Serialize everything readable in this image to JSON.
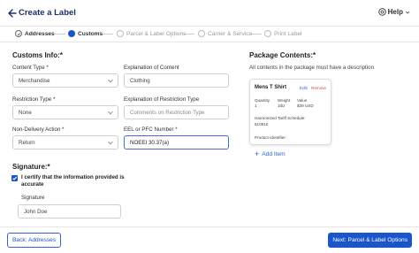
{
  "header": {
    "title": "Create a Label",
    "help_label": "Help"
  },
  "stepper": {
    "steps": [
      {
        "label": "Addresses",
        "state": "done"
      },
      {
        "label": "Customs",
        "state": "active"
      },
      {
        "label": "Parcel & Label Options",
        "state": "pending"
      },
      {
        "label": "Carrier & Service",
        "state": "pending"
      },
      {
        "label": "Print Label",
        "state": "pending"
      }
    ]
  },
  "customs": {
    "title": "Customs Info:*",
    "content_type": {
      "label": "Content Type *",
      "value": "Merchandise"
    },
    "explanation_content": {
      "label": "Explanation of Content",
      "value": "Clothing"
    },
    "restriction_type": {
      "label": "Restriction Type *",
      "value": "None"
    },
    "explanation_restriction": {
      "label": "Explanation of Restriction Type",
      "placeholder": "Comments on Restriction Type"
    },
    "non_delivery": {
      "label": "Non-Delivery Action *",
      "value": "Return"
    },
    "eel_pfc": {
      "label": "EEL or PFC Number *",
      "value": "NOEEI 30.37(a)"
    }
  },
  "signature": {
    "title": "Signature:*",
    "certify_text": "I certify that the information provided is accurate",
    "checked": true,
    "field_label": "Signature",
    "value": "John Doe"
  },
  "package": {
    "title": "Package Contents:*",
    "hint": "All contents in the package must have a description",
    "item": {
      "name": "Mens T Shirt",
      "edit_label": "Edit",
      "separator": "|",
      "remove_label": "Remove",
      "quantity_label": "Quantity",
      "quantity_value": "1",
      "weight_label": "Weight",
      "weight_value": "1lbz",
      "value_label": "Value",
      "value_value": "$39 USD",
      "tariff_label": "Harmonized Tariff Schedule:",
      "tariff_value": "610910",
      "identifier_label": "Product Identifier:"
    },
    "add_item_label": "Add Item"
  },
  "footer": {
    "back_label": "Back: Addresses",
    "next_label": "Next: Parcel & Label Options"
  },
  "colors": {
    "accent": "#1a56c9",
    "title": "#1b2f66",
    "remove": "#d24a4a"
  }
}
